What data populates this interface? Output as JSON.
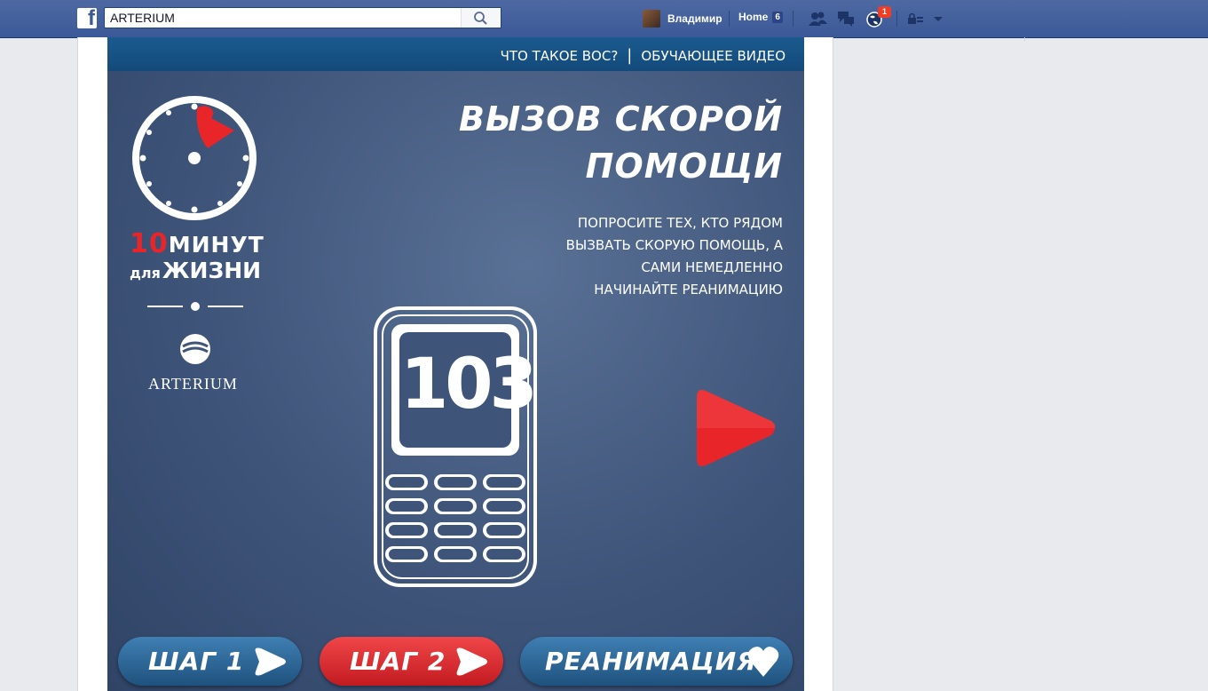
{
  "topbar": {
    "search_value": "ARTERIUM",
    "user_name": "Владимир",
    "home_label": "Home",
    "home_count": "6",
    "notifications_count": "1"
  },
  "app": {
    "nav": {
      "what_is": "ЧТО ТАКОЕ ВОС?",
      "separator": "|",
      "tutorial": "ОБУЧАЮЩЕЕ ВИДЕО"
    },
    "title_line1": "ВЫЗОВ СКОРОЙ",
    "title_line2": "ПОМОЩИ",
    "desc_line1": "ПОПРОСИТЕ ТЕХ, КТО РЯДОМ",
    "desc_line2": "ВЫЗВАТЬ СКОРУЮ ПОМОЩЬ, А",
    "desc_line3": "САМИ НЕМЕДЛЕННО",
    "desc_line4": "НАЧИНАЙТЕ РЕАНИМАЦИЮ",
    "logo_number": "10",
    "logo_word1": "МИНУТ",
    "logo_small": "для",
    "logo_word2": "ЖИЗНИ",
    "brand": "ARTERIUM",
    "phone_number": "103",
    "buttons": {
      "step1": "ШАГ 1",
      "step2": "ШАГ 2",
      "reanimation": "РЕАНИМАЦИЯ"
    }
  },
  "colors": {
    "facebook_blue": "#3b5998",
    "accent_red": "#e8262a",
    "button_blue": "#2a6394"
  }
}
